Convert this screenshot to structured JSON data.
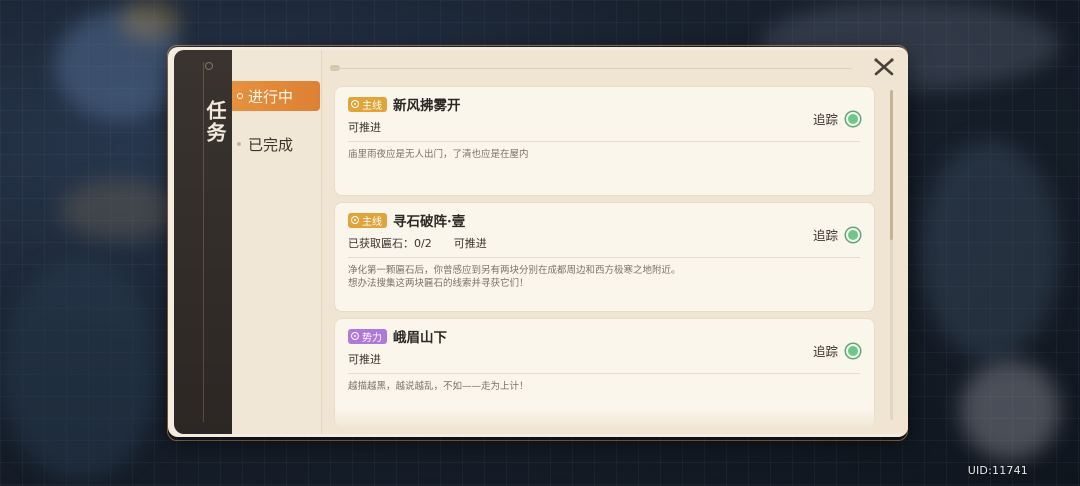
{
  "sidebar": {
    "title": "任务"
  },
  "tabs": [
    {
      "label": "进行中",
      "active": true
    },
    {
      "label": "已完成",
      "active": false
    }
  ],
  "quests": [
    {
      "badge": "主线",
      "badge_type": "main",
      "title": "新风拂雾开",
      "status": [
        "可推进"
      ],
      "track_label": "追踪",
      "description": [
        "庙里雨夜应是无人出门，了清也应是在屋内"
      ]
    },
    {
      "badge": "主线",
      "badge_type": "main",
      "title": "寻石破阵·壹",
      "status": [
        "已获取匾石：0/2",
        "可推进"
      ],
      "track_label": "追踪",
      "description": [
        "净化第一颗匾石后，你曾感应到另有两块分别在成都周边和西方极寒之地附近。",
        "想办法搜集这两块匾石的线索并寻获它们！"
      ]
    },
    {
      "badge": "势力",
      "badge_type": "faction",
      "title": "峨眉山下",
      "status": [
        "可推进"
      ],
      "track_label": "追踪",
      "description": [
        "越描越黑，越说越乱，不如——走为上计！"
      ]
    }
  ],
  "uid": "UID:11741",
  "colors": {
    "tab_active": "#e6913e",
    "badge_main": "#e0a43a",
    "badge_faction": "#b078d8",
    "track_dot": "#6cc889"
  },
  "icons": [
    "close-icon",
    "track-indicator-icon"
  ]
}
